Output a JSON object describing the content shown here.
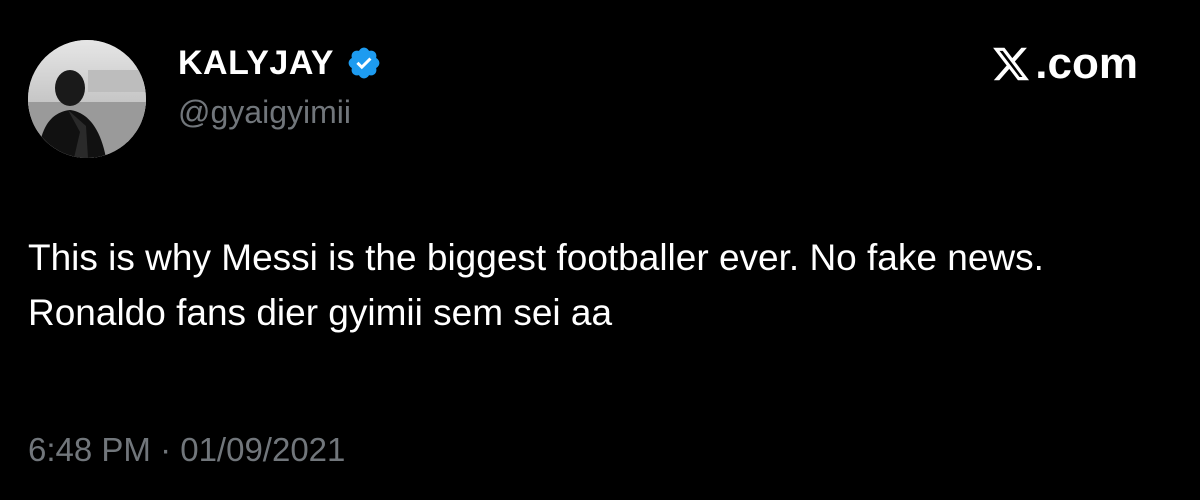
{
  "author": {
    "display_name": "KALYJAY",
    "handle": "@gyaigyimii",
    "verified_icon": "verified-badge-icon",
    "avatar": "profile-photo"
  },
  "site": {
    "logo_icon": "x-logo-icon",
    "label": ".com"
  },
  "tweet": {
    "text": "This is why Messi is the biggest footballer ever. No fake news. Ronaldo fans dier gyimii sem sei aa",
    "timestamp": "6:48 PM · 01/09/2021"
  },
  "colors": {
    "background": "#000000",
    "text_primary": "#ffffff",
    "text_secondary": "#71767b",
    "verified_blue": "#1d9bf0"
  }
}
